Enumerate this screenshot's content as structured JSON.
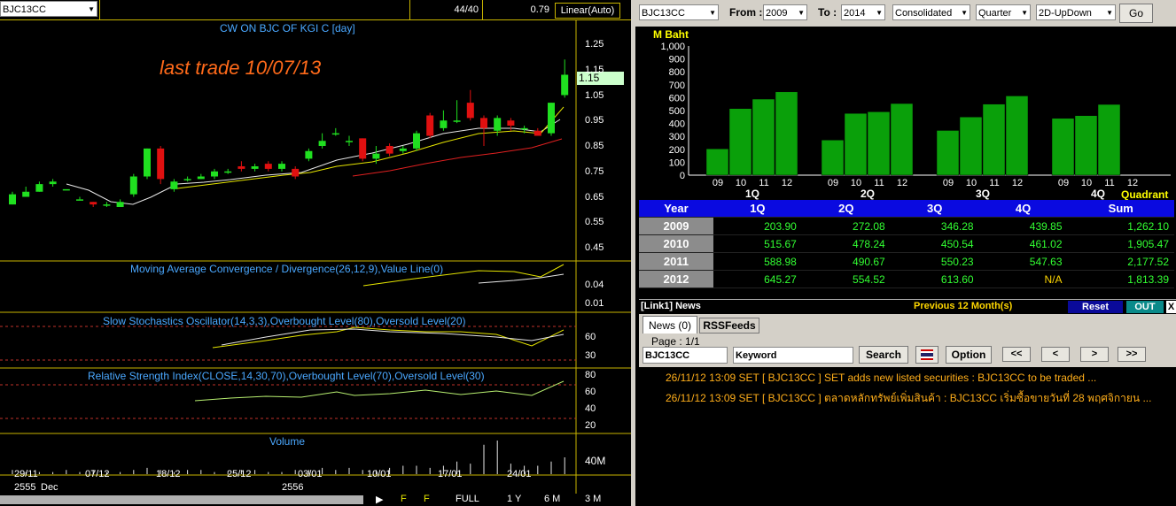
{
  "left": {
    "symbol": "BJC13CC",
    "ratio": "44/40",
    "last_value": "0.79",
    "scale_mode": "Linear(Auto)",
    "chart_title": "CW ON BJC OF KGI   C [day]",
    "annotation": "last trade 10/07/13",
    "price_tag": "1.15",
    "price_axis": [
      "1.25",
      "1.15",
      "1.05",
      "0.95",
      "0.85",
      "0.75",
      "0.65",
      "0.55",
      "0.45"
    ],
    "macd_title": "Moving Average Convergence / Divergence(26,12,9),Value Line(0)",
    "macd_axis": [
      "0.04",
      "0.01"
    ],
    "stoch_title": "Slow Stochastics Oscillator(14,3,3),Overbought Level(80),Oversold Level(20)",
    "stoch_axis": [
      "60",
      "30"
    ],
    "rsi_title": "Relative Strength Index(CLOSE,14,30,70),Overbought Level(70),Oversold Level(30)",
    "rsi_axis": [
      "80",
      "60",
      "40",
      "20"
    ],
    "volume_title": "Volume",
    "volume_axis": "40M",
    "date_labels": [
      "29/11",
      "07/12",
      "18/12",
      "25/12",
      "03/01",
      "10/01",
      "17/01",
      "24/01"
    ],
    "year_labels": [
      "2555",
      "Dec",
      "2556"
    ],
    "range_buttons": [
      "FULL",
      "1 Y",
      "6 M",
      "3 M"
    ],
    "candles": [
      {
        "o": 0.62,
        "c": 0.66,
        "h": 0.67,
        "l": 0.62
      },
      {
        "o": 0.65,
        "c": 0.67,
        "h": 0.69,
        "l": 0.65
      },
      {
        "o": 0.67,
        "c": 0.7,
        "h": 0.71,
        "l": 0.67
      },
      {
        "o": 0.7,
        "c": 0.71,
        "h": 0.72,
        "l": 0.69
      },
      {
        "o": 0.68,
        "c": 0.68,
        "h": 0.68,
        "l": 0.68
      },
      {
        "o": 0.64,
        "c": 0.64,
        "h": 0.65,
        "l": 0.64
      },
      {
        "o": 0.63,
        "c": 0.62,
        "h": 0.63,
        "l": 0.61
      },
      {
        "o": 0.62,
        "c": 0.62,
        "h": 0.63,
        "l": 0.61
      },
      {
        "o": 0.61,
        "c": 0.63,
        "h": 0.64,
        "l": 0.61
      },
      {
        "o": 0.66,
        "c": 0.73,
        "h": 0.74,
        "l": 0.65
      },
      {
        "o": 0.73,
        "c": 0.84,
        "h": 0.84,
        "l": 0.72
      },
      {
        "o": 0.84,
        "c": 0.72,
        "h": 0.85,
        "l": 0.7
      },
      {
        "o": 0.68,
        "c": 0.71,
        "h": 0.72,
        "l": 0.67
      },
      {
        "o": 0.72,
        "c": 0.72,
        "h": 0.73,
        "l": 0.71
      },
      {
        "o": 0.72,
        "c": 0.73,
        "h": 0.74,
        "l": 0.72
      },
      {
        "o": 0.73,
        "c": 0.75,
        "h": 0.76,
        "l": 0.72
      },
      {
        "o": 0.75,
        "c": 0.75,
        "h": 0.76,
        "l": 0.74
      },
      {
        "o": 0.77,
        "c": 0.76,
        "h": 0.79,
        "l": 0.75
      },
      {
        "o": 0.76,
        "c": 0.77,
        "h": 0.78,
        "l": 0.75
      },
      {
        "o": 0.78,
        "c": 0.76,
        "h": 0.79,
        "l": 0.75
      },
      {
        "o": 0.76,
        "c": 0.78,
        "h": 0.79,
        "l": 0.75
      },
      {
        "o": 0.76,
        "c": 0.73,
        "h": 0.77,
        "l": 0.72
      },
      {
        "o": 0.8,
        "c": 0.83,
        "h": 0.84,
        "l": 0.79
      },
      {
        "o": 0.85,
        "c": 0.87,
        "h": 0.9,
        "l": 0.84
      },
      {
        "o": 0.9,
        "c": 0.9,
        "h": 0.92,
        "l": 0.89
      },
      {
        "o": 0.87,
        "c": 0.87,
        "h": 0.89,
        "l": 0.85
      },
      {
        "o": 0.88,
        "c": 0.8,
        "h": 0.88,
        "l": 0.79
      },
      {
        "o": 0.8,
        "c": 0.82,
        "h": 0.85,
        "l": 0.78
      },
      {
        "o": 0.85,
        "c": 0.82,
        "h": 0.86,
        "l": 0.81
      },
      {
        "o": 0.83,
        "c": 0.84,
        "h": 0.85,
        "l": 0.82
      },
      {
        "o": 0.84,
        "c": 0.9,
        "h": 0.91,
        "l": 0.83
      },
      {
        "o": 0.97,
        "c": 0.89,
        "h": 0.98,
        "l": 0.88
      },
      {
        "o": 0.92,
        "c": 0.95,
        "h": 0.99,
        "l": 0.91
      },
      {
        "o": 0.95,
        "c": 0.95,
        "h": 1.03,
        "l": 0.94
      },
      {
        "o": 1.02,
        "c": 0.96,
        "h": 1.07,
        "l": 0.95
      },
      {
        "o": 0.96,
        "c": 0.92,
        "h": 0.97,
        "l": 0.85
      },
      {
        "o": 0.91,
        "c": 0.96,
        "h": 0.97,
        "l": 0.89
      },
      {
        "o": 0.95,
        "c": 0.93,
        "h": 0.96,
        "l": 0.91
      },
      {
        "o": 0.92,
        "c": 0.92,
        "h": 0.93,
        "l": 0.9
      },
      {
        "o": 0.91,
        "c": 0.89,
        "h": 0.92,
        "l": 0.89
      },
      {
        "o": 0.9,
        "c": 1.02,
        "h": 1.02,
        "l": 0.89
      },
      {
        "o": 1.05,
        "c": 1.13,
        "h": 1.19,
        "l": 1.04
      }
    ],
    "volumes": [
      2,
      1,
      1,
      1,
      2,
      1,
      2,
      1,
      1,
      2,
      3,
      2,
      1,
      2,
      2,
      1,
      1,
      2,
      2,
      1,
      1,
      2,
      2,
      3,
      2,
      3,
      2,
      2,
      3,
      4,
      4,
      3,
      4,
      6,
      5,
      14,
      16,
      5,
      4,
      4,
      6,
      8
    ]
  },
  "right": {
    "symbol": "BJC13CC",
    "from_label": "From :",
    "from_year": "2009",
    "to_label": "To :",
    "to_year": "2014",
    "mode": "Consolidated",
    "period": "Quarter",
    "view": "2D-UpDown",
    "go_label": "Go",
    "unit_label": "M Baht",
    "y_ticks": [
      "1,000",
      "900",
      "800",
      "700",
      "600",
      "500",
      "400",
      "300",
      "200",
      "100",
      "0"
    ],
    "x_year_labels": [
      "09",
      "10",
      "11",
      "12"
    ],
    "quadrant_label": "Quadrant",
    "bar_color": "#0aa00a",
    "chart_data": {
      "type": "bar",
      "groups": [
        "1Q",
        "2Q",
        "3Q",
        "4Q"
      ],
      "series": [
        {
          "name": "2009",
          "values": [
            203.9,
            272.08,
            346.28,
            439.85
          ]
        },
        {
          "name": "2010",
          "values": [
            515.67,
            478.24,
            450.54,
            461.02
          ]
        },
        {
          "name": "2011",
          "values": [
            588.98,
            490.67,
            550.23,
            547.63
          ]
        },
        {
          "name": "2012",
          "values": [
            645.27,
            554.52,
            613.6,
            null
          ]
        }
      ],
      "ylim": [
        0,
        1000
      ],
      "ylabel": "M Baht"
    },
    "table": {
      "headers": [
        "Year",
        "1Q",
        "2Q",
        "3Q",
        "4Q",
        "Sum"
      ],
      "rows": [
        [
          "2009",
          "203.90",
          "272.08",
          "346.28",
          "439.85",
          "1,262.10"
        ],
        [
          "2010",
          "515.67",
          "478.24",
          "450.54",
          "461.02",
          "1,905.47"
        ],
        [
          "2011",
          "588.98",
          "490.67",
          "550.23",
          "547.63",
          "2,177.52"
        ],
        [
          "2012",
          "645.27",
          "554.52",
          "613.60",
          "N/A",
          "1,813.39"
        ]
      ]
    },
    "news": {
      "title": "[Link1] News",
      "previous": "Previous 12 Month(s)",
      "reset_label": "Reset",
      "out_label": "OUT",
      "close_label": "X",
      "tab_news": "News (0)",
      "tab_rss": "RSSFeeds",
      "page_label": "Page : 1/1",
      "symbol_value": "BJC13CC",
      "keyword_value": "Keyword",
      "search_label": "Search",
      "option_label": "Option",
      "nav": [
        "<<",
        "<",
        ">",
        ">>"
      ],
      "items": [
        "26/11/12 13:09  SET  [ BJC13CC ]  SET adds new listed securities : BJC13CC to be traded ...",
        "26/11/12 13:09  SET  [ BJC13CC ]  ตลาดหลักทรัพย์เพิ่มสินค้า : BJC13CC เริ่มซื้อขายวันที่ 28 พฤศจิกายน ..."
      ]
    }
  }
}
